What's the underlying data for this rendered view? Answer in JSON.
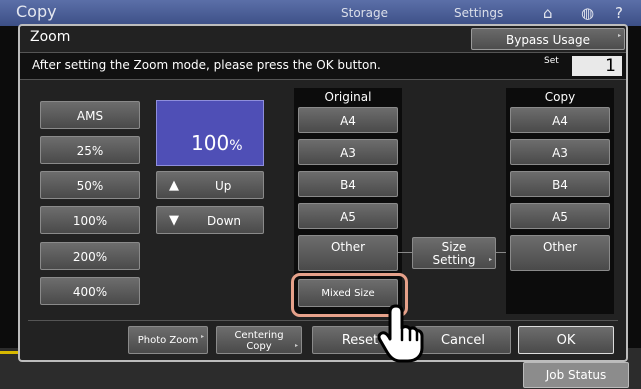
{
  "app": {
    "title": "Copy",
    "tabs": [
      "Storage",
      "Settings"
    ],
    "job_status": "Job Status"
  },
  "dialog": {
    "title": "Zoom",
    "bypass_usage": "Bypass Usage",
    "message": "After setting the Zoom mode, please press the OK button.",
    "set_label": "Set",
    "set_value": "1"
  },
  "zoom": {
    "presets": [
      "AMS",
      "25%",
      "50%",
      "100%",
      "200%",
      "400%"
    ],
    "display_value": "100",
    "display_unit": "%",
    "up_label": "Up",
    "down_label": "Down"
  },
  "original": {
    "header": "Original",
    "sizes": [
      "A4",
      "A3",
      "B4",
      "A5"
    ],
    "other_label": "Other",
    "mixed_size_label": "Mixed Size"
  },
  "size_setting": {
    "line1": "Size",
    "line2": "Setting"
  },
  "copy": {
    "header": "Copy",
    "sizes": [
      "A4",
      "A3",
      "B4",
      "A5"
    ],
    "other_label": "Other"
  },
  "footer": {
    "photo_zoom": "Photo Zoom",
    "centering_line1": "Centering",
    "centering_line2": "Copy",
    "reset": "Reset",
    "cancel": "Cancel",
    "ok": "OK"
  }
}
